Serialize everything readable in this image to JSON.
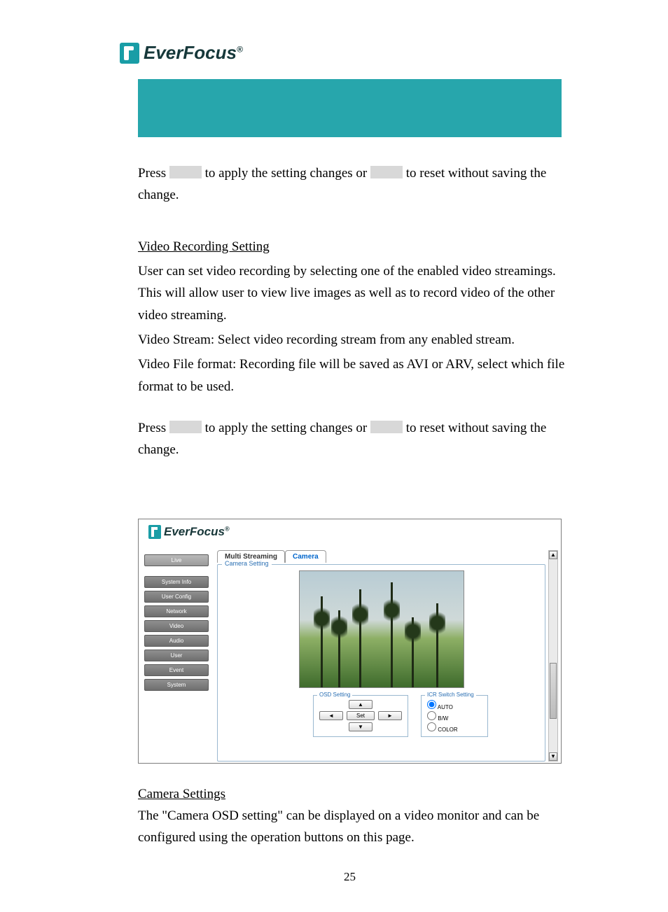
{
  "brand": "EverFocus",
  "registered": "®",
  "body": {
    "press1_a": "Press ",
    "press1_b": " to apply the setting changes or ",
    "press1_c": " to reset without saving the change.",
    "vrs_head": "Video Recording Setting",
    "vrs_p1": "User can set video recording by selecting one of the enabled video streamings. This will allow user to view live images as well as to record video of the other video streaming.",
    "vrs_p2": "Video Stream: Select video recording stream from any enabled stream.",
    "vrs_p3": "Video File format: Recording file will be saved as AVI or ARV, select which file format to be used.",
    "press2_a": "Press ",
    "press2_b": " to apply the setting changes or ",
    "press2_c": " to reset without saving the change.",
    "cam_head": "Camera Settings",
    "cam_p1": "The \"Camera OSD setting\" can be displayed on a video monitor and can be configured using the operation buttons on this page."
  },
  "app": {
    "brand": "EverFocus",
    "registered": "®",
    "sidebar": {
      "live": "Live",
      "items": [
        "System Info",
        "User Config",
        "Network",
        "Video",
        "Audio",
        "User",
        "Event",
        "System"
      ]
    },
    "tabs": {
      "multi": "Multi Streaming",
      "camera": "Camera"
    },
    "fieldset_legend": "Camera Setting",
    "osd": {
      "legend": "OSD Setting",
      "up": "▲",
      "down": "▼",
      "left": "◄",
      "right": "►",
      "set": "Set"
    },
    "icr": {
      "legend": "ICR Switch Setting",
      "auto": "AUTO",
      "bw": "B/W",
      "color": "COLOR"
    },
    "scroll": {
      "up": "▲",
      "down": "▼"
    }
  },
  "page_number": "25"
}
